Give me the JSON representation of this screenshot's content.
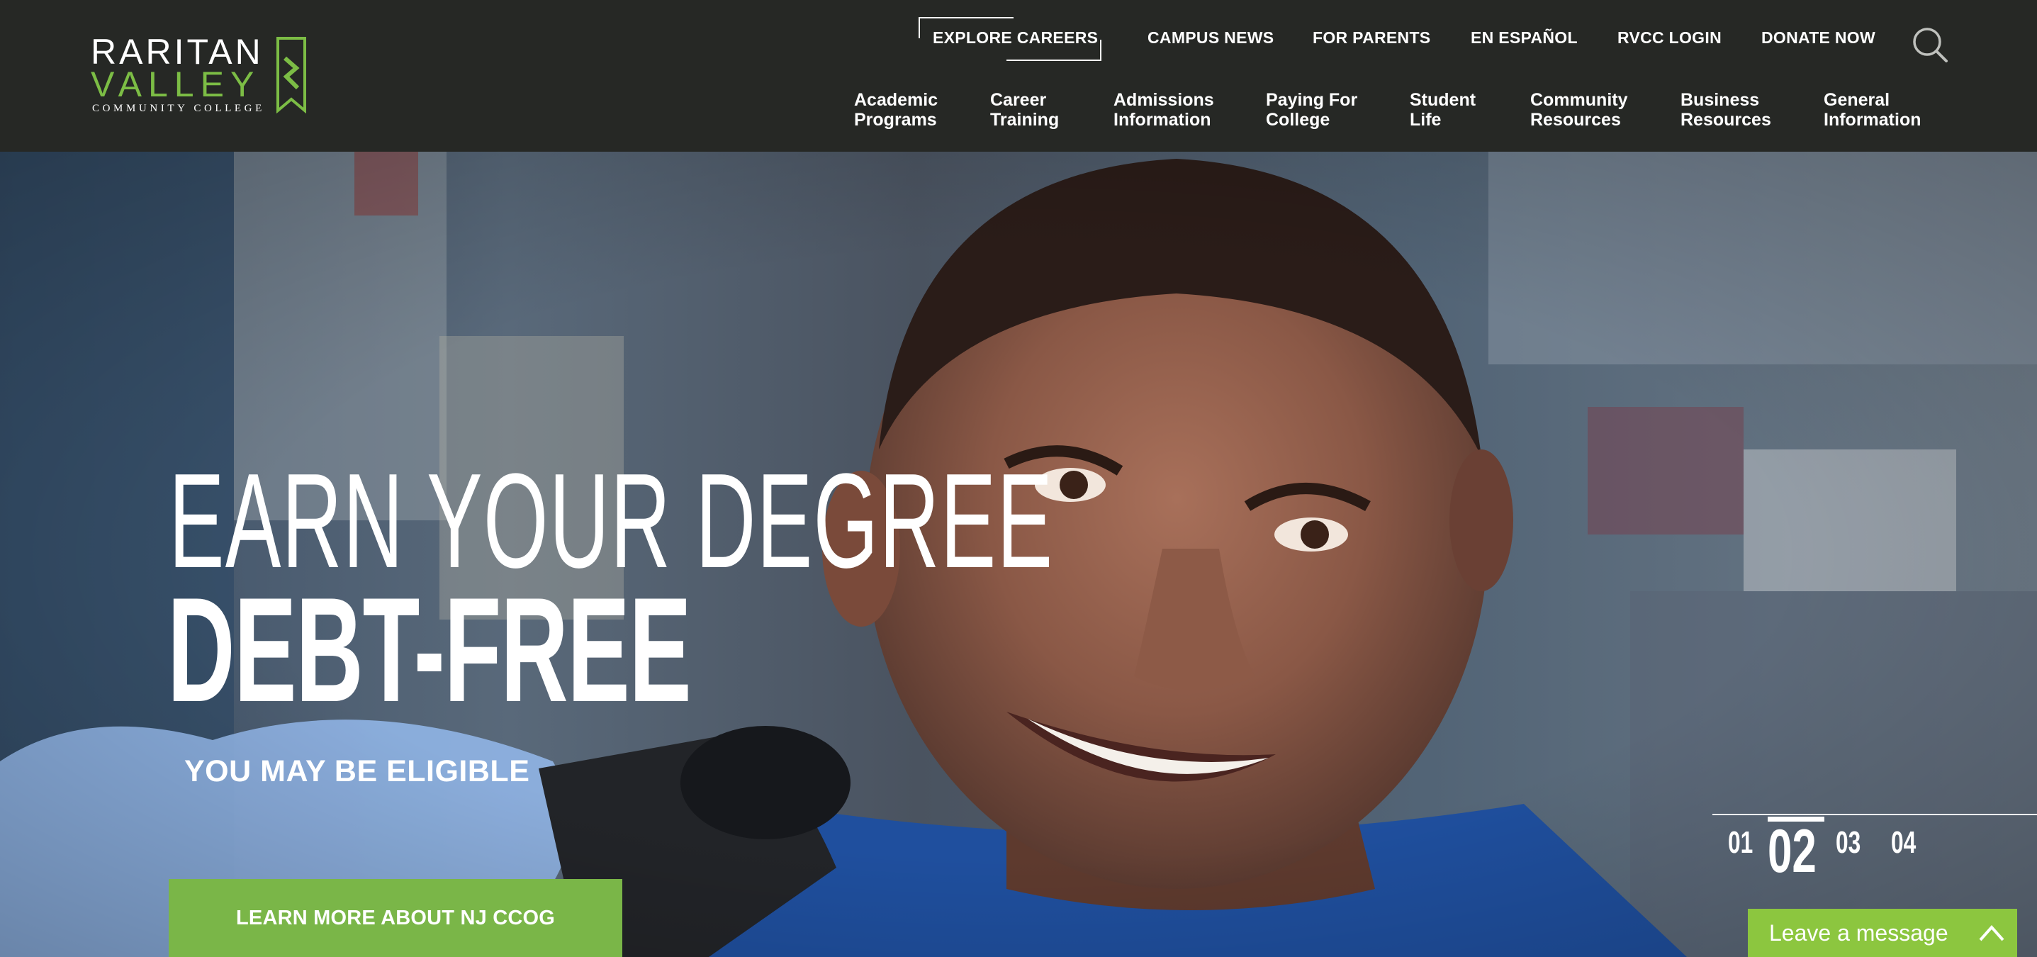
{
  "logo": {
    "line1": "RARITAN",
    "line2": "VALLEY",
    "line3": "COMMUNITY COLLEGE",
    "brand_green": "#7cbd45"
  },
  "utility_nav": [
    {
      "label": "EXPLORE CAREERS"
    },
    {
      "label": "CAMPUS NEWS"
    },
    {
      "label": "FOR PARENTS"
    },
    {
      "label": "EN ESPAÑOL"
    },
    {
      "label": "RVCC LOGIN"
    },
    {
      "label": "DONATE NOW"
    }
  ],
  "search": {
    "icon": "search-icon"
  },
  "main_nav": [
    {
      "line1": "Academic",
      "line2": "Programs"
    },
    {
      "line1": "Career",
      "line2": "Training"
    },
    {
      "line1": "Admissions",
      "line2": "Information"
    },
    {
      "line1": "Paying For",
      "line2": "College"
    },
    {
      "line1": "Student",
      "line2": "Life"
    },
    {
      "line1": "Community",
      "line2": "Resources"
    },
    {
      "line1": "Business",
      "line2": "Resources"
    },
    {
      "line1": "General",
      "line2": "Information"
    }
  ],
  "hero": {
    "headline_line1": "EARN YOUR DEGREE",
    "headline_line2": "DEBT-FREE",
    "subheadline": "YOU MAY BE ELIGIBLE",
    "cta_label": "LEARN MORE ABOUT NJ CCOG",
    "cta_color": "#7ab648"
  },
  "slider": {
    "slides": [
      "01",
      "02",
      "03",
      "04"
    ],
    "active_index": 1
  },
  "chat": {
    "label": "Leave a message",
    "color": "#8cc63f",
    "icon": "chevron-up-icon"
  },
  "colors": {
    "header_bg": "#262825"
  }
}
